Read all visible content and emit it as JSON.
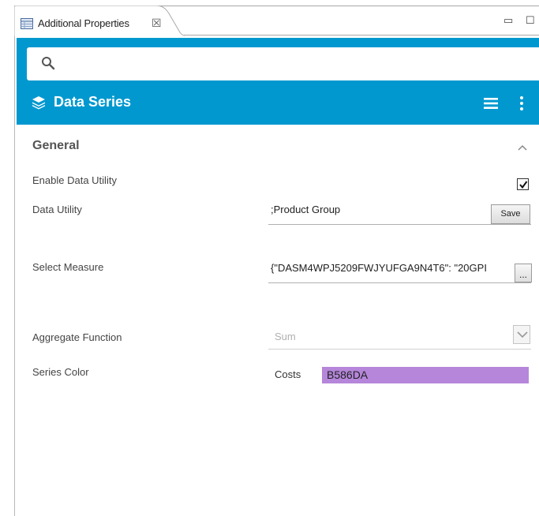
{
  "view_tab": {
    "title": "Additional Properties",
    "close_glyph": "☒"
  },
  "window_controls": {
    "minimize": "▭",
    "maximize": "☐"
  },
  "search": {
    "placeholder": ""
  },
  "header": {
    "title": "Data Series",
    "icon": "layers-icon",
    "menu_icon": "hamburger-icon",
    "more_icon": "kebab-icon",
    "color": "#0098cf"
  },
  "section": {
    "title": "General"
  },
  "fields": {
    "enable_data_utility": {
      "label": "Enable Data Utility",
      "checked": true
    },
    "data_utility": {
      "label": "Data Utility",
      "value": ";Product Group",
      "button": "Save"
    },
    "select_measure": {
      "label": "Select Measure",
      "value": "{\"DASM4WPJ5209FWJYUFGA9N4T6\": \"20GPI",
      "button": "..."
    },
    "aggregate_function": {
      "label": "Aggregate Function",
      "value": "Sum"
    },
    "series_color": {
      "label": "Series Color",
      "series_name": "Costs",
      "color_hex": "B586DA",
      "swatch_color": "#b586da"
    }
  }
}
